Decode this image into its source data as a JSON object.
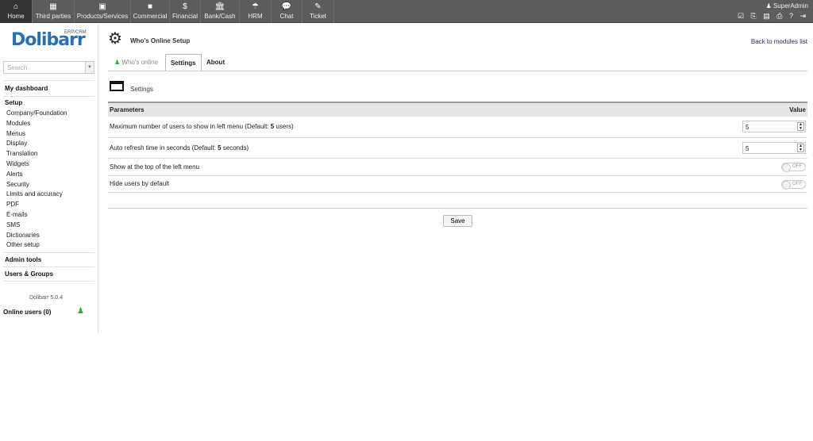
{
  "topnav": [
    {
      "label": "Home",
      "icon": "⌂"
    },
    {
      "label": "Third parties",
      "icon": "▦"
    },
    {
      "label": "Products/Services",
      "icon": "▣"
    },
    {
      "label": "Commercial",
      "icon": "■"
    },
    {
      "label": "Financial",
      "icon": "$"
    },
    {
      "label": "Bank/Cash",
      "icon": "🏛"
    },
    {
      "label": "HRM",
      "icon": "☂"
    },
    {
      "label": "Chat",
      "icon": "💬"
    },
    {
      "label": "Ticket",
      "icon": "✎"
    }
  ],
  "user": "SuperAdmin",
  "toolicons": "☑ ⎘ ▤ ⎙ ? ⇥",
  "sidebar": {
    "logo": "Dolibarr",
    "logo_sub": "ERP/CRM",
    "search_placeholder": "Search",
    "my_dashboard": "My dashboard",
    "setup": "Setup",
    "setup_items": [
      "Company/Foundation",
      "Modules",
      "Menus",
      "Display",
      "Translation",
      "Widgets",
      "Alerts",
      "Security",
      "Limits and accuracy",
      "PDF",
      "E-mails",
      "SMS",
      "Dictionaries",
      "Other setup"
    ],
    "admin_tools": "Admin tools",
    "users_groups": "Users & Groups",
    "version": "Dolibarr 5.0.4",
    "online_users": "Online users (0)"
  },
  "main": {
    "title": "Who's Online Setup",
    "back_link": "Back to modules list",
    "tabs": [
      "Who's online",
      "Settings",
      "About"
    ],
    "section": "Settings",
    "table": {
      "col_params": "Parameters",
      "col_value": "Value",
      "rows": [
        {
          "label": "Maximum number of users to show in left menu  (Default: ",
          "bold": "5",
          "suffix": " users)",
          "value": "5"
        },
        {
          "label": "Auto refresh time in seconds  (Default: ",
          "bold": "5",
          "suffix": " seconds)",
          "value": "5"
        },
        {
          "label": "Show at the top of the left menu",
          "toggle": "OFF"
        },
        {
          "label": "Hide users by default",
          "toggle": "OFF"
        }
      ]
    },
    "save": "Save"
  }
}
